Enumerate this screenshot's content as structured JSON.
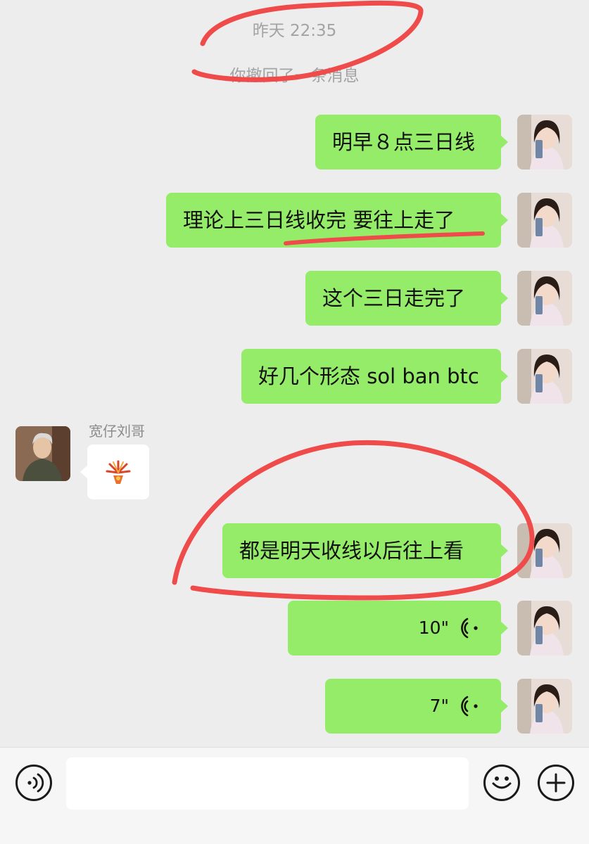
{
  "chat": {
    "timestamp": "昨天 22:35",
    "recall_notice": "你撤回了一条消息",
    "messages": [
      {
        "type": "text",
        "text": "明早８点三日线"
      },
      {
        "type": "text",
        "text": "理论上三日线收完 要往上走了"
      },
      {
        "type": "text",
        "text": "这个三日走完了"
      },
      {
        "type": "text",
        "text": "好几个形态 sol ban btc"
      },
      {
        "type": "sticker",
        "sender": "宽仔刘哥",
        "icon": "fireworks-sticker"
      },
      {
        "type": "text",
        "text": "都是明天收线以后往上看"
      },
      {
        "type": "voice",
        "duration": "10\""
      },
      {
        "type": "voice",
        "duration": "7\""
      }
    ]
  },
  "input_bar": {
    "message_value": "",
    "voice_button_icon": "voice-mode-icon",
    "emoji_button_icon": "emoji-icon",
    "more_button_icon": "plus-icon"
  },
  "colors": {
    "background": "#ededed",
    "my_bubble": "#95ec69",
    "other_bubble": "#ffffff",
    "annotation": "#ef4b4b"
  }
}
